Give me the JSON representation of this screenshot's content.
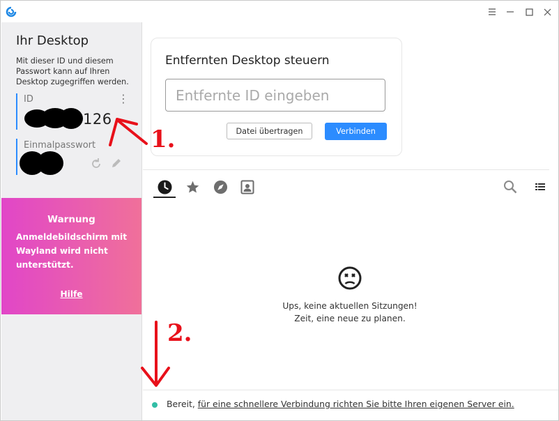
{
  "window": {
    "controls": [
      "menu-icon",
      "minimize-icon",
      "maximize-icon",
      "close-icon"
    ]
  },
  "left": {
    "title": "Ihr Desktop",
    "description": "Mit dieser ID und diesem Passwort kann auf Ihren Desktop zugegriffen werden.",
    "id_label": "ID",
    "id_value_visible": "126",
    "password_label": "Einmalpasswort"
  },
  "warning": {
    "title": "Warnung",
    "message": "Anmeldebildschirm mit Wayland wird nicht unterstützt.",
    "link": "Hilfe"
  },
  "connect": {
    "title": "Entfernten Desktop steuern",
    "placeholder": "Entfernte ID eingeben",
    "value": "",
    "file_transfer": "Datei übertragen",
    "connect": "Verbinden"
  },
  "tabs": [
    {
      "icon": "clock-icon",
      "active": true
    },
    {
      "icon": "star-icon",
      "active": false
    },
    {
      "icon": "compass-icon",
      "active": false
    },
    {
      "icon": "address-book-icon",
      "active": false
    }
  ],
  "tools": [
    "search-icon",
    "list-view-icon"
  ],
  "empty": {
    "icon": "sad-face-icon",
    "line1": "Ups, keine aktuellen Sitzungen!",
    "line2": "Zeit, eine neue zu planen."
  },
  "status": {
    "state": "Bereit,",
    "link": "für eine schnellere Verbindung richten Sie bitte Ihren eigenen Server ein."
  },
  "annotations": {
    "label1": "1.",
    "label2": "2."
  },
  "colors": {
    "accent": "#2c8cff",
    "warning_start": "#e146c8",
    "warning_end": "#f0709a",
    "status_ok": "#32bea6",
    "annotation": "#e8101a"
  }
}
